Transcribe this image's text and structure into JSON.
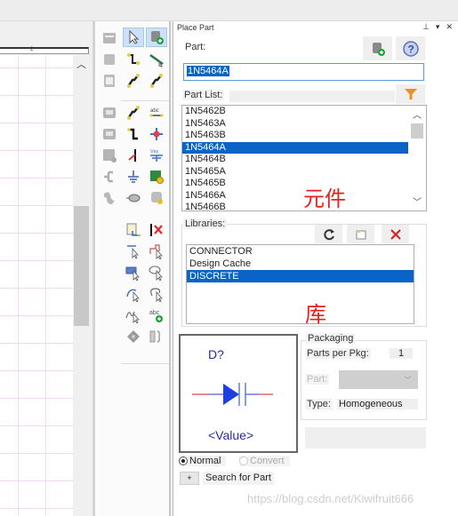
{
  "canvas": {
    "ruler_mark": "2"
  },
  "palette": {
    "tools": [
      {
        "name": "place-hierarchical-block-tool",
        "selected": false
      },
      {
        "name": "select-tool",
        "selected": true
      },
      {
        "name": "place-part-tool",
        "selected": true
      },
      {
        "name": "place-pin-tool",
        "selected": false
      },
      {
        "name": "place-wire-tool",
        "selected": false
      },
      {
        "name": "place-net-group-tool",
        "selected": false
      },
      {
        "name": "place-hierarchical-port-tool",
        "selected": false
      },
      {
        "name": "place-bus-tool",
        "selected": false
      },
      {
        "name": "place-auto-wire-tool",
        "selected": false
      },
      {
        "name": "place-off-page-connector-tool",
        "selected": false
      },
      {
        "name": "place-auto-bus-tool",
        "selected": false
      },
      {
        "name": "place-net-alias-tool",
        "selected": false
      },
      {
        "name": "place-pin-array-tool",
        "selected": false
      },
      {
        "name": "place-bus-entry-tool",
        "selected": false
      },
      {
        "name": "place-junction-tool",
        "selected": false
      },
      {
        "name": "place-hierarchical-pin-tool",
        "selected": false
      },
      {
        "name": "place-power-tool",
        "selected": false
      },
      {
        "name": "place-power-vss-tool",
        "selected": false
      },
      {
        "name": "place-net-tree-tool",
        "selected": false
      },
      {
        "name": "place-ground-tool",
        "selected": false
      },
      {
        "name": "place-ic-tool",
        "selected": false
      },
      {
        "name": "place-graphic-tool",
        "selected": false
      },
      {
        "name": "place-ellipse-tool",
        "selected": false
      },
      {
        "name": "place-picture-tool",
        "selected": false
      },
      {
        "name": "place-ieee-symbol-tool",
        "selected": false
      },
      {
        "name": "place-no-connect-tool",
        "selected": false
      },
      {
        "name": "place-line-tool",
        "selected": false
      },
      {
        "name": "place-polyline-tool",
        "selected": false
      },
      {
        "name": "place-rectangle-tool",
        "selected": false
      },
      {
        "name": "place-ellipse-outline-tool",
        "selected": false
      },
      {
        "name": "place-arc-tool",
        "selected": false
      },
      {
        "name": "place-elliptical-arc-tool",
        "selected": false
      },
      {
        "name": "place-bezier-tool",
        "selected": false
      },
      {
        "name": "place-text-tool",
        "selected": false
      },
      {
        "name": "snap-to-grid-tool",
        "selected": false
      },
      {
        "name": "group-tool",
        "selected": false
      }
    ]
  },
  "panel": {
    "title": "Place Part",
    "controls": {
      "pin": "⊥",
      "menu": "▾",
      "close": "✕"
    },
    "part_label": "Part:",
    "part_value": "1N5464A",
    "part_list_label": "Part List:",
    "part_list": {
      "items": [
        "1N5462B",
        "1N5463A",
        "1N5463B",
        "1N5464A",
        "1N5464B",
        "1N5465A",
        "1N5465B",
        "1N5466A",
        "1N5466B"
      ],
      "selected": "1N5464A"
    },
    "annotation_parts": "元件",
    "libraries_label": "Libraries:",
    "libraries": {
      "items": [
        "CONNECTOR",
        "Design Cache",
        "DISCRETE"
      ],
      "selected": "DISCRETE"
    },
    "annotation_libraries": "库",
    "preview": {
      "refdes": "D?",
      "value": "<Value>"
    },
    "packaging": {
      "title": "Packaging",
      "parts_per_pkg_label": "Parts per Pkg:",
      "parts_per_pkg_value": "1",
      "part_label": "Part:",
      "part_value": "",
      "type_label": "Type:",
      "type_value": "Homogeneous"
    },
    "view_mode": {
      "normal_label": "Normal",
      "convert_label": "Convert",
      "selected": "Normal"
    },
    "search_button": "+",
    "search_label": "Search for Part",
    "watermark": "https://blog.csdn.net/Kiwifruit666"
  },
  "colors": {
    "selection": "#0a64c8",
    "annotation": "#e8201c",
    "symbol": "#2a2aa0",
    "pin": "#e04040"
  }
}
